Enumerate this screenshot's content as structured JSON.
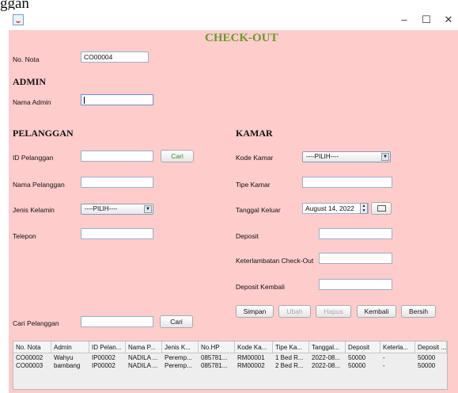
{
  "caption_text": "ggan",
  "window": {
    "minimize": "–",
    "maximize": "☐",
    "close": "✕"
  },
  "header": {
    "title": "CHECK-OUT"
  },
  "nota": {
    "label": "No. Nota",
    "value": "CO00004"
  },
  "admin": {
    "section": "ADMIN",
    "label": "Nama Admin",
    "value": ""
  },
  "pelanggan": {
    "section": "PELANGGAN",
    "id_label": "ID Pelanggan",
    "id_value": "",
    "cari_button": "Cari",
    "nama_label": "Nama Pelanggan",
    "nama_value": "",
    "jk_label": "Jenis Kelamin",
    "jk_value": "----PILIH----",
    "telepon_label": "Telepon",
    "telepon_value": ""
  },
  "kamar": {
    "section": "KAMAR",
    "kode_label": "Kode Kamar",
    "kode_value": "----PILIH----",
    "tipe_label": "Tipe Kamar",
    "tipe_value": "",
    "tanggal_label": "Tanggal Keluar",
    "tanggal_value": "August 14, 2022",
    "deposit_label": "Deposit",
    "deposit_value": "",
    "terlambat_label": "Keterlambatan Check-Out",
    "terlambat_value": "",
    "deposit_kembali_label": "Deposit Kembali",
    "deposit_kembali_value": ""
  },
  "actions": {
    "simpan": "Simpan",
    "ubah": "Ubah",
    "hapus": "Hapus",
    "kembali": "Kembali",
    "bersih": "Bersih"
  },
  "search": {
    "label": "Cari Pelanggan",
    "value": "",
    "button": "Cari"
  },
  "table": {
    "columns": [
      "No. Nota",
      "Admin",
      "ID Pelan...",
      "Nama P...",
      "Jenis K...",
      "No.HP",
      "Kode Ka...",
      "Tipe Ka...",
      "Tanggal...",
      "Deposit",
      "Keterla...",
      "Deposit ..."
    ],
    "rows": [
      [
        "CO00002",
        "Wahyu",
        "IP00002",
        "NADILA ...",
        "Peremp...",
        "085781...",
        "RM00001",
        "1 Bed R...",
        "2022-08...",
        "50000",
        "-",
        "50000"
      ],
      [
        "CO00003",
        "bambang",
        "IP00002",
        "NADILA ...",
        "Peremp...",
        "085781...",
        "RM00002",
        "2 Bed R...",
        "2022-08...",
        "50000",
        "-",
        "50000"
      ]
    ]
  }
}
